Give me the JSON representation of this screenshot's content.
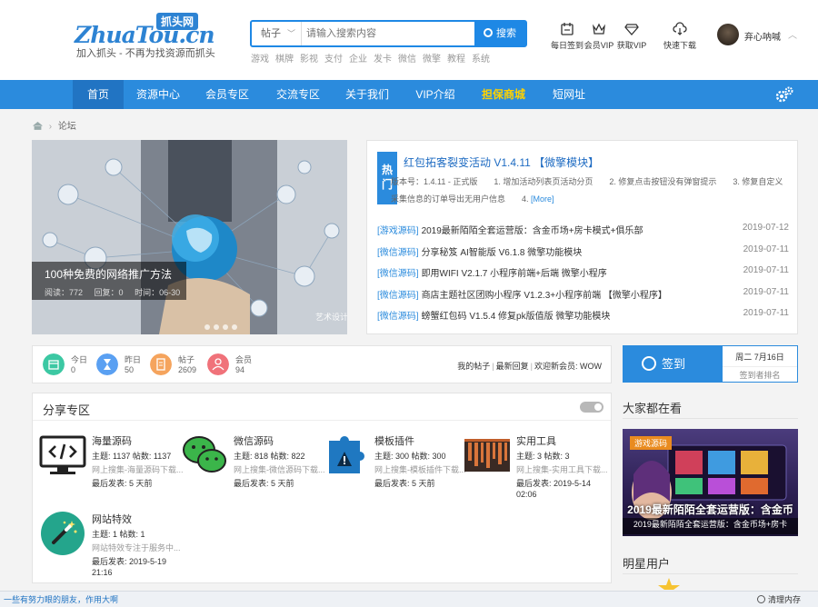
{
  "header": {
    "logo_text": "ZhuaTou.cn",
    "logo_badge": "抓头网",
    "slogan": "加入抓头 - 不再为找资源而抓头",
    "search_type": "帖子",
    "search_placeholder": "请输入搜索内容",
    "search_button": "搜索",
    "hot_words": [
      "游戏",
      "棋牌",
      "影视",
      "支付",
      "企业",
      "发卡",
      "微信",
      "微擎",
      "教程",
      "系统"
    ],
    "quick_links": [
      {
        "label": "每日签到",
        "icon": "calendar-icon"
      },
      {
        "label": "会员VIP",
        "icon": "crown-icon"
      },
      {
        "label": "获取VIP",
        "icon": "diamond-icon"
      },
      {
        "label": "快速下载",
        "icon": "cloud-download-icon"
      }
    ],
    "user_name": "弃心呐喊"
  },
  "nav": {
    "items": [
      "首页",
      "资源中心",
      "会员专区",
      "交流专区",
      "关于我们",
      "VIP介绍",
      "担保商城",
      "短网址"
    ],
    "active_index": 0,
    "highlight_index": 6
  },
  "breadcrumb": {
    "current": "论坛"
  },
  "slider": {
    "title": "100种免费的网络推广方法",
    "views_label": "阅读：772",
    "replies_label": "回复：0",
    "time_label": "时间：06-30",
    "watermark": "艺术设计&网络"
  },
  "hot": {
    "tag": "热门",
    "title": "红包拓客裂变活动 V1.4.11 【微擎模块】",
    "desc": "版本号：1.4.11 - 正式版　　1. 增加活动列表页活动分页　　2. 修复点击按钮没有弹窗提示　　3. 修复自定义采集信息的订单导出无用户信息　　4.",
    "more": "[More]",
    "list": [
      {
        "cat": "[游戏源码]",
        "title": "2019最新陌陌全套运营版：含金币场+房卡模式+俱乐部",
        "date": "2019-07-12"
      },
      {
        "cat": "[微信源码]",
        "title": "分享秘笈 AI智能版 V6.1.8 微擎功能模块",
        "date": "2019-07-11"
      },
      {
        "cat": "[微信源码]",
        "title": "即用WIFI V2.1.7 小程序前端+后端 微擎小程序",
        "date": "2019-07-11"
      },
      {
        "cat": "[微信源码]",
        "title": "商店主题社区团购小程序 V1.2.3+小程序前端 【微擎小程序】",
        "date": "2019-07-11"
      },
      {
        "cat": "[微信源码]",
        "title": "螃蟹红包码 V1.5.4 修复pk版值版 微擎功能模块",
        "date": "2019-07-11"
      }
    ]
  },
  "stats": {
    "items": [
      {
        "label": "今日",
        "value": "0",
        "color": "#3cc8a3"
      },
      {
        "label": "昨日",
        "value": "50",
        "color": "#5aa0f2"
      },
      {
        "label": "帖子",
        "value": "2609",
        "color": "#f5a45d"
      },
      {
        "label": "会员",
        "value": "94",
        "color": "#f0727a"
      }
    ],
    "links": [
      "我的帖子",
      "最新回复",
      "欢迎新会员: WOW"
    ]
  },
  "sign": {
    "button": "签到",
    "date": "周二 7月16日",
    "rank": "签到者排名"
  },
  "share": {
    "title": "分享专区",
    "forums": [
      {
        "name": "海量源码",
        "stats": "主题: 1137 帖数: 1137",
        "intro": "网上搜集-海量源码下载...",
        "last": "最后发表: 5 天前",
        "last2": "",
        "icon": "code-monitor-icon"
      },
      {
        "name": "微信源码",
        "stats": "主题: 818 帖数: 822",
        "intro": "网上搜集-微信源码下载...",
        "last": "最后发表: 5 天前",
        "last2": "",
        "icon": "wechat-icon"
      },
      {
        "name": "模板插件",
        "stats": "主题: 300 帖数: 300",
        "intro": "网上搜集-模板插件下载...",
        "last": "最后发表: 5 天前",
        "last2": "",
        "icon": "puzzle-icon"
      },
      {
        "name": "实用工具",
        "stats": "主题: 3 帖数: 3",
        "intro": "网上搜集-实用工具下载...",
        "last": "最后发表: 2019-5-14",
        "last2": "02:06",
        "icon": "toolbox-icon"
      },
      {
        "name": "网站特效",
        "stats": "主题: 1 帖数: 1",
        "intro": "网站特效专注于服务中...",
        "last": "最后发表: 2019-5-19",
        "last2": "21:16",
        "icon": "magic-wand-icon"
      }
    ]
  },
  "side": {
    "watch_title": "大家都在看",
    "watch_badge": "游戏源码",
    "watch_big": "2019最新陌陌全套运营版：含金币",
    "watch_caption": "2019最新陌陌全套运营版：含金币场+房卡",
    "star_title": "明星用户"
  },
  "statusbar": {
    "left": "一些有努力眼的朋友，作用大啊",
    "right": "清理内存"
  },
  "colors": {
    "brand": "#2b8bdd",
    "highlight": "#ffd200"
  }
}
